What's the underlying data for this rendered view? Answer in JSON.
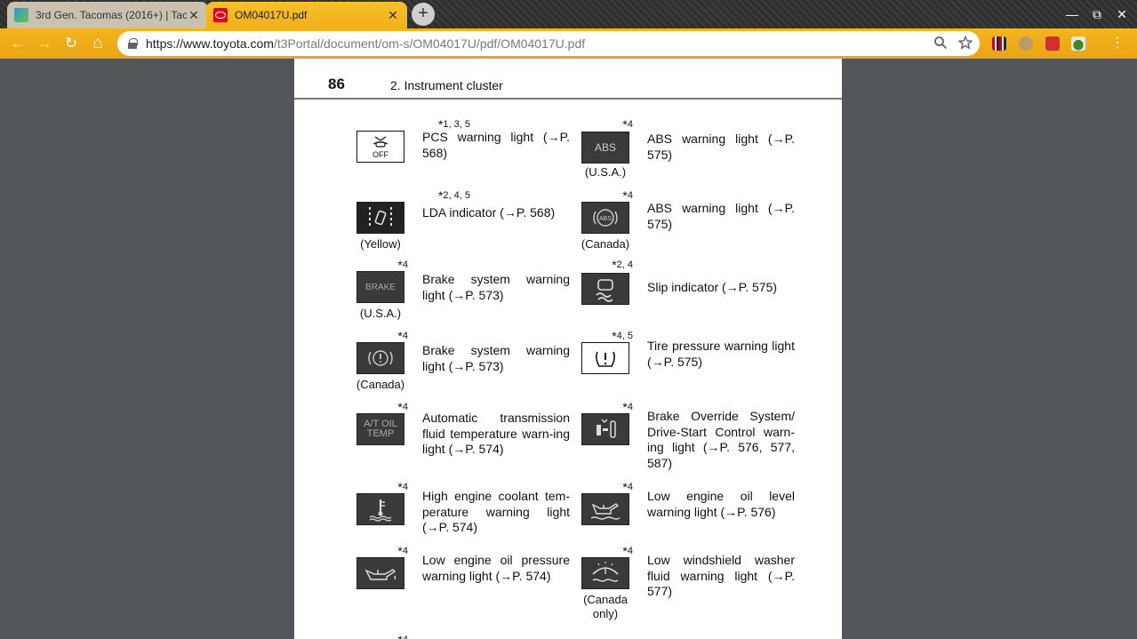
{
  "tabs": [
    {
      "title": "3rd Gen. Tacomas (2016+) | Tac",
      "close": "✕",
      "active": false
    },
    {
      "title": "OM04017U.pdf",
      "close": "✕",
      "active": true
    }
  ],
  "new_tab_glyph": "+",
  "window_controls": {
    "minimize": "—",
    "restore": "⧉",
    "close": "✕"
  },
  "nav": {
    "back": "←",
    "forward": "→",
    "reload": "↻",
    "home": "⌂"
  },
  "address": {
    "host": "https://www.toyota.com",
    "path": "/t3Portal/document/om-s/OM04017U/pdf/OM04017U.pdf"
  },
  "page": {
    "number": "86",
    "section": "2. Instrument cluster",
    "entries": [
      {
        "sup": "1, 3, 5",
        "icon": "pcs-off-icon",
        "caption": "",
        "desc": "PCS warning light (→P. 568)"
      },
      {
        "sup": "4",
        "icon": "abs-text-icon",
        "caption": "(U.S.A.)",
        "desc": "ABS warning light (→P. 575)"
      },
      {
        "sup": "2, 4, 5",
        "icon": "lda-icon",
        "caption": "(Yellow)",
        "desc": "LDA indicator (→P. 568)"
      },
      {
        "sup": "4",
        "icon": "abs-circle-icon",
        "caption": "(Canada)",
        "desc": "ABS warning light (→P. 575)"
      },
      {
        "sup": "4",
        "icon": "brake-text-icon",
        "caption": "(U.S.A.)",
        "desc": "Brake system warning light (→P. 573)"
      },
      {
        "sup": "2, 4",
        "icon": "slip-icon",
        "caption": "",
        "desc": "Slip indicator (→P. 575)"
      },
      {
        "sup": "4",
        "icon": "brake-circle-icon",
        "caption": "(Canada)",
        "desc": "Brake system warning light (→P. 573)"
      },
      {
        "sup": "4, 5",
        "icon": "tire-pressure-icon",
        "caption": "",
        "desc": "Tire pressure warning light (→P. 575)"
      },
      {
        "sup": "4",
        "icon": "at-oil-temp-icon",
        "caption": "",
        "desc": "Automatic transmission fluid temperature warn-ing light (→P. 574)"
      },
      {
        "sup": "4",
        "icon": "brake-override-icon",
        "caption": "",
        "desc": "Brake Override System/ Drive-Start Control warn-ing light (→P. 576, 577, 587)"
      },
      {
        "sup": "4",
        "icon": "coolant-temp-icon",
        "caption": "",
        "desc": "High engine coolant tem-perature warning light (→P. 574)"
      },
      {
        "sup": "4",
        "icon": "oil-level-icon",
        "caption": "",
        "desc": "Low engine oil level warning light (→P. 576)"
      },
      {
        "sup": "4",
        "icon": "oil-pressure-icon",
        "caption": "",
        "desc": "Low engine oil pressure warning light (→P. 574)"
      },
      {
        "sup": "4",
        "icon": "washer-fluid-icon",
        "caption": "(Canada only)",
        "desc": "Low windshield washer fluid warning light (→P. 577)"
      },
      {
        "sup": "4",
        "icon": "",
        "caption": "",
        "desc": ""
      }
    ],
    "icon_texts": {
      "off": "OFF",
      "abs": "ABS",
      "brake": "BRAKE",
      "at_oil_temp": "A/T OIL TEMP"
    }
  }
}
